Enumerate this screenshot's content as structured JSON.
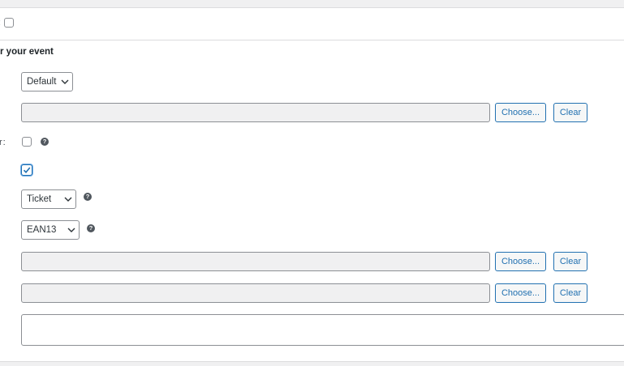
{
  "top_row": {
    "label_fragment": ":"
  },
  "section": {
    "title": "r your event"
  },
  "template_select": {
    "value": "Default"
  },
  "image_1": {
    "value": "",
    "choose_label": "Choose...",
    "clear_label": "Clear"
  },
  "option_row": {
    "label_fragment": "r:",
    "help": "?"
  },
  "checked_option": {
    "checked": true
  },
  "type_select": {
    "value": "Ticket",
    "help": "?"
  },
  "barcode_select": {
    "value": "EAN13",
    "help": "?"
  },
  "image_2": {
    "value": "",
    "choose_label": "Choose...",
    "clear_label": "Clear"
  },
  "image_3": {
    "value": "",
    "choose_label": "Choose...",
    "clear_label": "Clear"
  },
  "notes": {
    "value": ""
  },
  "colors": {
    "accent": "#2271b1",
    "field_bg": "#f0f0f1",
    "border": "#8c8f94"
  }
}
